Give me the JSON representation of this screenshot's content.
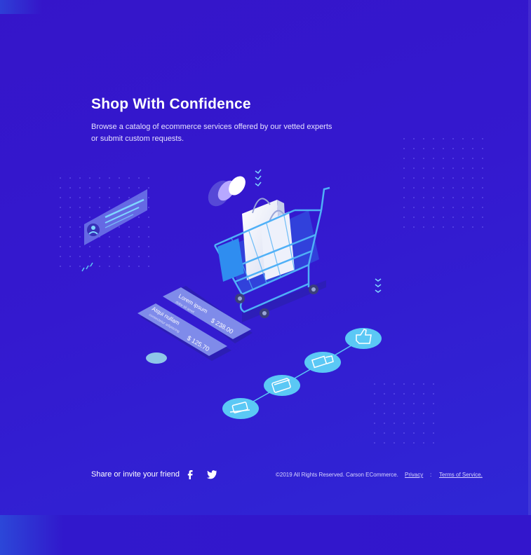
{
  "hero": {
    "title": "Shop With Confidence",
    "description": "Browse a catalog of ecommerce services offered by our vetted experts or submit custom requests."
  },
  "illustration": {
    "card_top": {
      "heading": "Lorem ipsum",
      "sub": "dolor sit amet",
      "price": "$ 238.00"
    },
    "card_bottom": {
      "heading": "Atqui nullam",
      "sub": "consectetur adipiscing",
      "price": "$ 125.70"
    },
    "flow_icons": [
      "hand-money-icon",
      "credit-card-icon",
      "truck-icon",
      "thumbs-up-icon"
    ]
  },
  "footer": {
    "share_text": "Share or invite your friend",
    "social": [
      "facebook-icon",
      "twitter-icon"
    ],
    "copyright": "©2019 All Rights Reserved. Carson ECommerce.",
    "privacy_label": "Privacy",
    "separator": ":",
    "terms_label": "Terms of Service."
  },
  "colors": {
    "background": "#3419cf",
    "accent_light": "#5bc8f5",
    "cart_blue": "#2f8df0"
  }
}
